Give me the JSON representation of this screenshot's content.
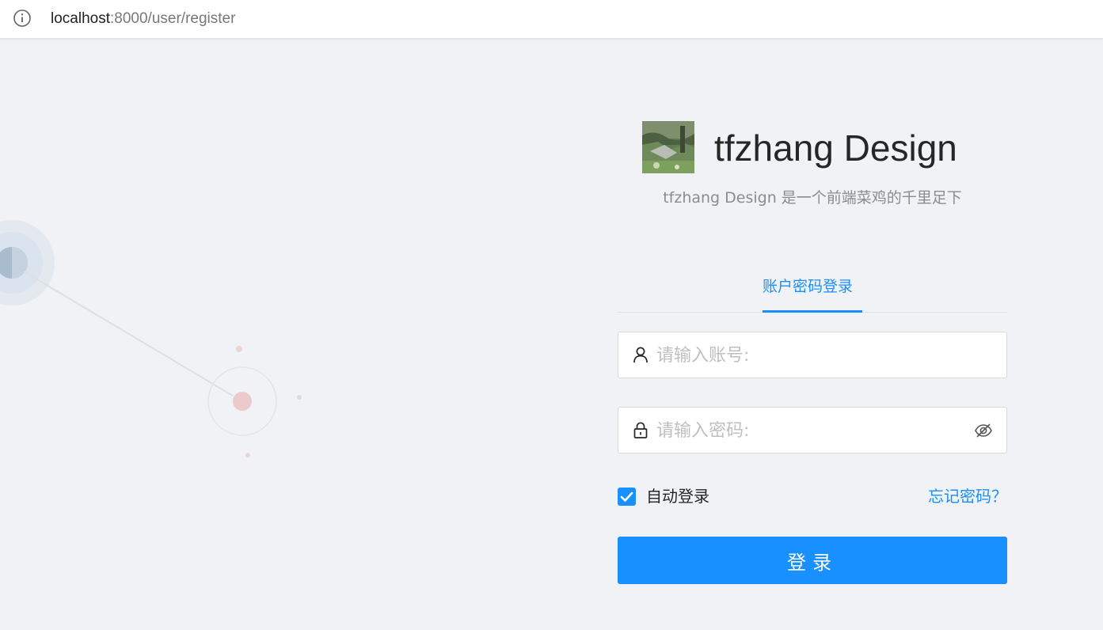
{
  "browser": {
    "url_host": "localhost",
    "url_rest": ":8000/user/register"
  },
  "brand": {
    "title": "tfzhang Design",
    "description": "tfzhang Design 是一个前端菜鸡的千里足下"
  },
  "tabs": [
    {
      "label": "账户密码登录",
      "active": true
    }
  ],
  "form": {
    "username_placeholder": "请输入账号:",
    "password_placeholder": "请输入密码:",
    "remember_label": "自动登录",
    "remember_checked": true,
    "forgot_label": "忘记密码？",
    "submit_label": "登录"
  },
  "colors": {
    "primary": "#1890ff",
    "background": "#f0f2f5"
  },
  "icons": {
    "address_bar": "info-icon",
    "username": "user-icon",
    "password": "lock-icon",
    "password_toggle": "eye-invisible-icon",
    "checkbox": "check-icon"
  }
}
